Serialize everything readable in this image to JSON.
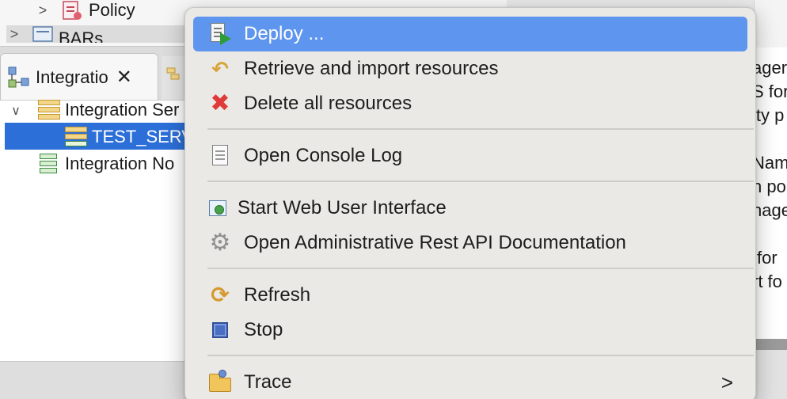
{
  "navigator": {
    "policy_label": "Policy",
    "bars_label": "BARs"
  },
  "view_tab": {
    "label": "Integratio",
    "close_glyph": "✕"
  },
  "tree": {
    "integration_server": "Integration Ser",
    "test_server": "TEST_SERV",
    "integration_node": "Integration No"
  },
  "right_panel": {
    "lines": [
      "ager",
      "S for",
      "ity p",
      "Nam",
      "n po",
      "nage",
      "for",
      "rt fo"
    ]
  },
  "context_menu": {
    "deploy": "Deploy ...",
    "retrieve": "Retrieve and import resources",
    "delete_all": "Delete all resources",
    "open_console_log": "Open Console Log",
    "start_web_ui": "Start Web User Interface",
    "open_rest_api_docs": "Open Administrative Rest API Documentation",
    "refresh": "Refresh",
    "stop": "Stop",
    "trace": "Trace",
    "submenu_glyph": ">"
  },
  "icons": {
    "deploy": "deploy-icon",
    "retrieve": "retrieve-icon",
    "delete": "delete-icon",
    "console_log": "console-log-icon",
    "web_ui": "web-ui-icon",
    "rest_api": "gear-icon",
    "refresh": "refresh-icon",
    "stop": "stop-icon",
    "trace": "trace-folder-icon"
  },
  "colors": {
    "menu_highlight": "#5e95ee",
    "tree_selection": "#2c6fd8",
    "menu_background": "#ebe9e6"
  }
}
